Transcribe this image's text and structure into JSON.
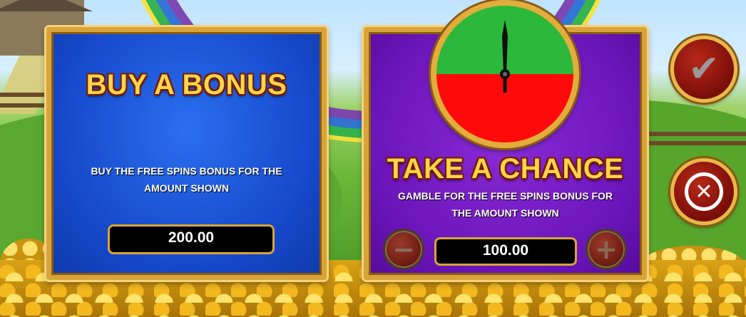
{
  "buy_bonus": {
    "title": "BUY A BONUS",
    "description_line1": "BUY THE FREE SPINS BONUS FOR THE",
    "description_line2": "AMOUNT SHOWN",
    "amount": "200.00"
  },
  "take_chance": {
    "title": "TAKE A CHANCE",
    "description_line1": "GAMBLE FOR THE FREE SPINS BONUS FOR",
    "description_line2": "THE AMOUNT SHOWN",
    "amount": "100.00",
    "decrease_icon": "minus-icon",
    "increase_icon": "plus-icon"
  },
  "gamble_wheel": {
    "win_color": "#2cb83a",
    "lose_color": "#ff0a0a",
    "win_fraction": 0.5
  },
  "controls": {
    "confirm_icon": "check-icon",
    "cancel_icon": "close-icon"
  },
  "colors": {
    "gold": "#ffd54a",
    "buy_panel": "#1546c8",
    "chance_panel": "#6a14b8",
    "button_red": "#7a0e08"
  }
}
